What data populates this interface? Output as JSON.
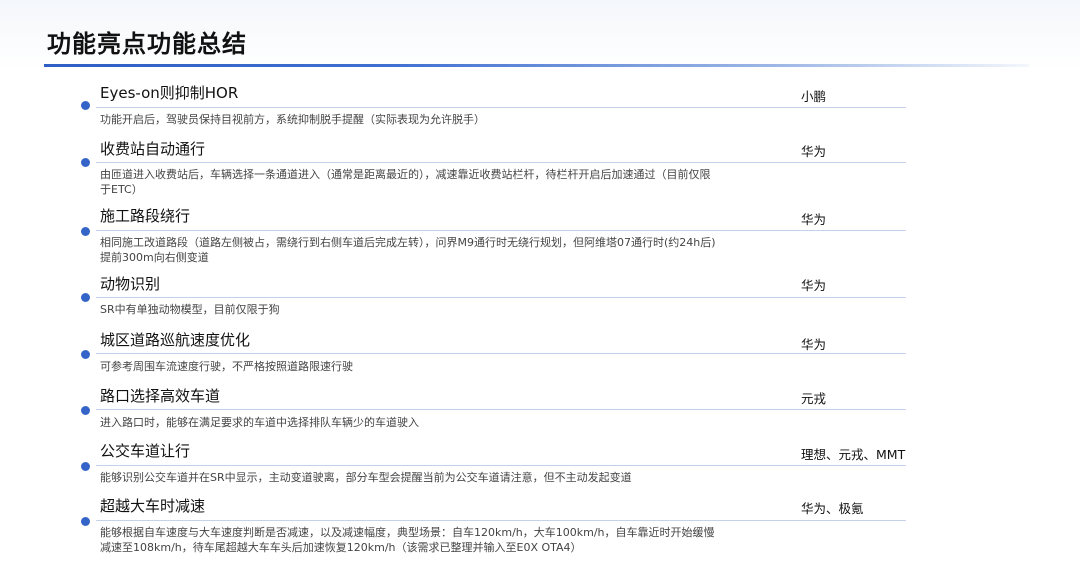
{
  "page": {
    "title": "功能亮点功能总结"
  },
  "features": [
    {
      "title": "Eyes-on则抑制HOR",
      "description": "功能开启后，驾驶员保持目视前方，系统抑制脱手提醒（实际表现为允许脱手）",
      "brands": "小鹏"
    },
    {
      "title": "收费站自动通行",
      "description": "由匝道进入收费站后，车辆选择一条通道进入（通常是距离最近的），减速靠近收费站栏杆，待栏杆开启后加速通过（目前仅限于ETC）",
      "brands": "华为"
    },
    {
      "title": "施工路段绕行",
      "description": "相同施工改道路段（道路左侧被占，需绕行到右侧车道后完成左转），问界M9通行时无绕行规划，但阿维塔07通行时(约24h后)提前300m向右侧变道",
      "brands": "华为"
    },
    {
      "title": "动物识别",
      "description": "SR中有单独动物模型，目前仅限于狗",
      "brands": "华为"
    },
    {
      "title": "城区道路巡航速度优化",
      "description": "可参考周围车流速度行驶，不严格按照道路限速行驶",
      "brands": "华为"
    },
    {
      "title": "路口选择高效车道",
      "description": "进入路口时，能够在满足要求的车道中选择排队车辆少的车道驶入",
      "brands": "元戎"
    },
    {
      "title": "公交车道让行",
      "description": "能够识别公交车道并在SR中显示，主动变道驶离，部分车型会提醒当前为公交车道请注意，但不主动发起变道",
      "brands": "理想、元戎、MMT"
    },
    {
      "title": "超越大车时减速",
      "description": "能够根据自车速度与大车速度判断是否减速，以及减速幅度，典型场景：自车120km/h，大车100km/h，自车靠近时开始缓慢减速至108km/h，待车尾超越大车车头后加速恢复120km/h（该需求已整理并输入至E0X OTA4）",
      "brands": "华为、极氪"
    }
  ]
}
